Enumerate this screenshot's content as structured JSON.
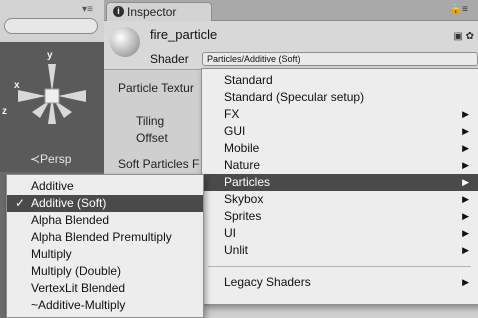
{
  "scene": {
    "menu_glyph": "▾≡",
    "axes": {
      "x": "x",
      "y": "y",
      "z": "z"
    },
    "persp_label": "≺Persp"
  },
  "inspector": {
    "tab_title": "Inspector",
    "info_icon": "i",
    "lock_glyph": "🔒≡",
    "material_name": "fire_particle",
    "shader_label": "Shader",
    "shader_value": "Particles/Additive (Soft)",
    "header_icons": "▣ ✿",
    "properties": {
      "particle_texture": "Particle Textur",
      "tiling": "Tiling",
      "offset": "Offset",
      "soft_particles": "Soft Particles F"
    }
  },
  "shader_menu": {
    "items": [
      {
        "label": "Standard",
        "submenu": false
      },
      {
        "label": "Standard (Specular setup)",
        "submenu": false
      },
      {
        "label": "FX",
        "submenu": true
      },
      {
        "label": "GUI",
        "submenu": true
      },
      {
        "label": "Mobile",
        "submenu": true
      },
      {
        "label": "Nature",
        "submenu": true
      },
      {
        "label": "Particles",
        "submenu": true,
        "highlighted": true
      },
      {
        "label": "Skybox",
        "submenu": true
      },
      {
        "label": "Sprites",
        "submenu": true
      },
      {
        "label": "UI",
        "submenu": true
      },
      {
        "label": "Unlit",
        "submenu": true
      }
    ],
    "legacy": {
      "label": "Legacy Shaders",
      "submenu": true
    },
    "arrow_glyph": "▶"
  },
  "particles_submenu": {
    "check_glyph": "✓",
    "items": [
      {
        "label": "Additive",
        "checked": false
      },
      {
        "label": "Additive (Soft)",
        "checked": true,
        "highlighted": true
      },
      {
        "label": "Alpha Blended",
        "checked": false
      },
      {
        "label": "Alpha Blended Premultiply",
        "checked": false
      },
      {
        "label": "Multiply",
        "checked": false
      },
      {
        "label": "Multiply (Double)",
        "checked": false
      },
      {
        "label": "VertexLit Blended",
        "checked": false
      },
      {
        "label": "~Additive-Multiply",
        "checked": false
      }
    ]
  },
  "colors": {
    "highlight": "#4a4a4a",
    "menu_bg": "#ededed"
  }
}
